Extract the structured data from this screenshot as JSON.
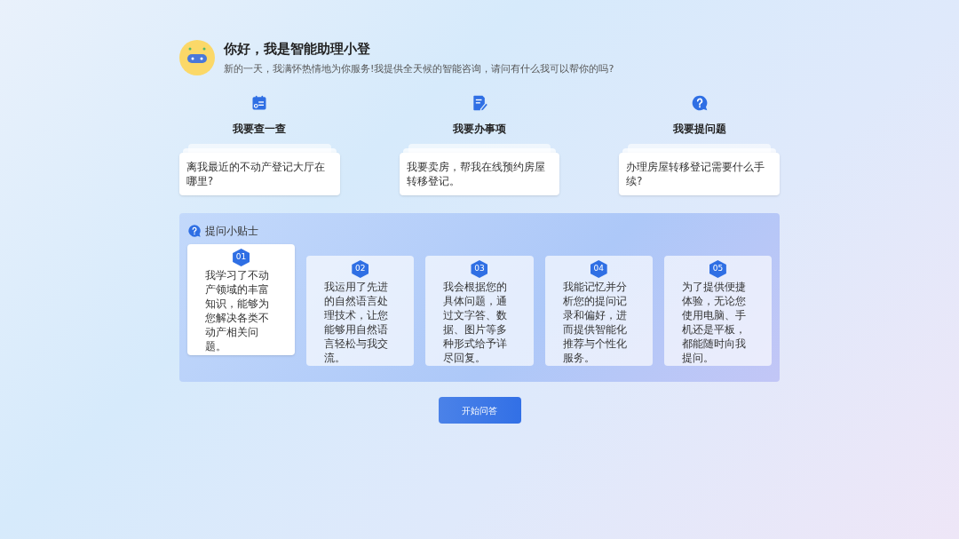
{
  "assistant": {
    "title": "你好，我是智能助理小登",
    "subtitle": "新的一天，我满怀热情地为你服务!我提供全天候的智能咨询，请问有什么我可以帮你的吗?"
  },
  "categories": [
    {
      "kind": "search",
      "title": "我要查一查",
      "example": "离我最近的不动产登记大厅在哪里?"
    },
    {
      "kind": "task",
      "title": "我要办事项",
      "example": "我要卖房，帮我在线预约房屋转移登记。"
    },
    {
      "kind": "question",
      "title": "我要提问题",
      "example": "办理房屋转移登记需要什么手续?"
    }
  ],
  "tips": {
    "title": "提问小贴士",
    "items": [
      {
        "number": "01",
        "text": "我学习了不动产领域的丰富知识，能够为您解决各类不动产相关问题。",
        "selected": true
      },
      {
        "number": "02",
        "text": "我运用了先进的自然语言处理技术，让您能够用自然语言轻松与我交流。",
        "selected": false
      },
      {
        "number": "03",
        "text": "我会根据您的具体问题，通过文字答、数据、图片等多种形式给予详尽回复。",
        "selected": false
      },
      {
        "number": "04",
        "text": "我能记忆并分析您的提问记录和偏好，进而提供智能化推荐与个性化服务。",
        "selected": false
      },
      {
        "number": "05",
        "text": "为了提供便捷体验，无论您使用电脑、手机还是平板，都能随时向我提问。",
        "selected": false
      }
    ]
  },
  "start_button": "开始问答"
}
